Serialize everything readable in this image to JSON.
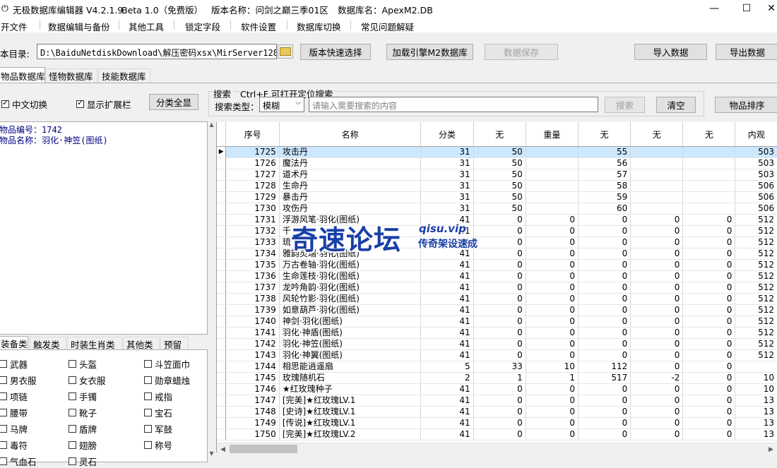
{
  "title": {
    "app_name": "无极数据库编辑器 V4.2.1.9",
    "beta": "Beta 1.0（免费版）",
    "version_name": "版本名称：问剑之巅三季01区",
    "db_name": "数据库名：ApexM2.DB",
    "minimize": "—",
    "maximize": "☐",
    "close": "✕"
  },
  "menu": [
    "开文件",
    "数据编辑与备份",
    "其他工具",
    "锁定字段",
    "软件设置",
    "数据库切换",
    "常见问题解疑"
  ],
  "toolbar": {
    "dir_label": "本目录:",
    "dir_value": "D:\\BaiduNetdiskDownload\\解压密码xsx\\MirServer128",
    "version_select": "版本快速选择",
    "load_engine": "加载引擎M2数据库",
    "save_data": "数据保存",
    "import_data": "导入数据",
    "export_data": "导出数据"
  },
  "tabs": [
    "物品数据库",
    "怪物数据库",
    "技能数据库"
  ],
  "options": {
    "chinese_switch": "中文切换",
    "show_ext": "显示扩展栏",
    "show_all": "分类全显"
  },
  "search": {
    "title": "搜索",
    "hint": "Ctrl+F 可打开定位搜索",
    "type_label": "搜索类型：",
    "type_value": "模糊",
    "placeholder": "请输入需要搜索的内容",
    "search_btn": "搜索",
    "clear_btn": "清空",
    "sort_btn": "物品排序"
  },
  "item_info": {
    "id_line": "物品编号：1742",
    "name_line": "物品名称：羽化·神笠(图纸)"
  },
  "category_tabs": [
    "装备类",
    "触发类",
    "时装生肖类",
    "其他类",
    "预留"
  ],
  "categories": [
    "武器",
    "头盔",
    "斗笠面巾",
    "男衣服",
    "女衣服",
    "勋章蜡烛",
    "项链",
    "手镯",
    "戒指",
    "腰带",
    "靴子",
    "宝石",
    "马牌",
    "盾牌",
    "军鼓",
    "毒符",
    "翅膀",
    "称号",
    "气血石",
    "灵石",
    ""
  ],
  "table": {
    "headers": [
      "序号",
      "名称",
      "分类",
      "无",
      "重量",
      "无",
      "无",
      "无",
      "内观"
    ],
    "rows": [
      [
        "1725",
        "攻击丹",
        "31",
        "50",
        "",
        "55",
        "",
        "",
        "503"
      ],
      [
        "1726",
        "魔法丹",
        "31",
        "50",
        "",
        "56",
        "",
        "",
        "503"
      ],
      [
        "1727",
        "道术丹",
        "31",
        "50",
        "",
        "57",
        "",
        "",
        "503"
      ],
      [
        "1728",
        "生命丹",
        "31",
        "50",
        "",
        "58",
        "",
        "",
        "506"
      ],
      [
        "1729",
        "暴击丹",
        "31",
        "50",
        "",
        "59",
        "",
        "",
        "506"
      ],
      [
        "1730",
        "攻伤丹",
        "31",
        "50",
        "",
        "60",
        "",
        "",
        "506"
      ],
      [
        "1731",
        "浮游风笔·羽化(图纸)",
        "41",
        "0",
        "0",
        "0",
        "0",
        "0",
        "512"
      ],
      [
        "1732",
        "千",
        "41",
        "0",
        "0",
        "0",
        "0",
        "0",
        "512"
      ],
      [
        "1733",
        "琉",
        "41",
        "0",
        "0",
        "0",
        "0",
        "0",
        "512"
      ],
      [
        "1734",
        "雅韵灵瑞·羽化(图纸)",
        "41",
        "0",
        "0",
        "0",
        "0",
        "0",
        "512"
      ],
      [
        "1735",
        "万古卷轴·羽化(图纸)",
        "41",
        "0",
        "0",
        "0",
        "0",
        "0",
        "512"
      ],
      [
        "1736",
        "生命莲枝·羽化(图纸)",
        "41",
        "0",
        "0",
        "0",
        "0",
        "0",
        "512"
      ],
      [
        "1737",
        "龙吟角韵·羽化(图纸)",
        "41",
        "0",
        "0",
        "0",
        "0",
        "0",
        "512"
      ],
      [
        "1738",
        "风轮竹影·羽化(图纸)",
        "41",
        "0",
        "0",
        "0",
        "0",
        "0",
        "512"
      ],
      [
        "1739",
        "如意葫芦·羽化(图纸)",
        "41",
        "0",
        "0",
        "0",
        "0",
        "0",
        "512"
      ],
      [
        "1740",
        "神剑·羽化(图纸)",
        "41",
        "0",
        "0",
        "0",
        "0",
        "0",
        "512"
      ],
      [
        "1741",
        "羽化·神盾(图纸)",
        "41",
        "0",
        "0",
        "0",
        "0",
        "0",
        "512"
      ],
      [
        "1742",
        "羽化·神笠(图纸)",
        "41",
        "0",
        "0",
        "0",
        "0",
        "0",
        "512"
      ],
      [
        "1743",
        "羽化·神翼(图纸)",
        "41",
        "0",
        "0",
        "0",
        "0",
        "0",
        "512"
      ],
      [
        "1744",
        "相思能逍遥扇",
        "5",
        "33",
        "10",
        "112",
        "0",
        "0",
        ""
      ],
      [
        "1745",
        "玫瑰随机石",
        "2",
        "1",
        "1",
        "517",
        "-2",
        "0",
        "10"
      ],
      [
        "1746",
        "★红玫瑰种子",
        "41",
        "0",
        "0",
        "0",
        "0",
        "0",
        "10"
      ],
      [
        "1747",
        "[完美]★红玫瑰LV.1",
        "41",
        "0",
        "0",
        "0",
        "0",
        "0",
        "13"
      ],
      [
        "1748",
        "[史诗]★红玫瑰LV.1",
        "41",
        "0",
        "0",
        "0",
        "0",
        "0",
        "13"
      ],
      [
        "1749",
        "[传说]★红玫瑰LV.1",
        "41",
        "0",
        "0",
        "0",
        "0",
        "0",
        "13"
      ],
      [
        "1750",
        "[完美]★红玫瑰LV.2",
        "41",
        "0",
        "0",
        "0",
        "0",
        "0",
        "13"
      ]
    ],
    "selected_row": 0
  },
  "watermark": {
    "big": "奇速论坛",
    "url": "qisu.vip",
    "sub": "传奇架设速成"
  }
}
